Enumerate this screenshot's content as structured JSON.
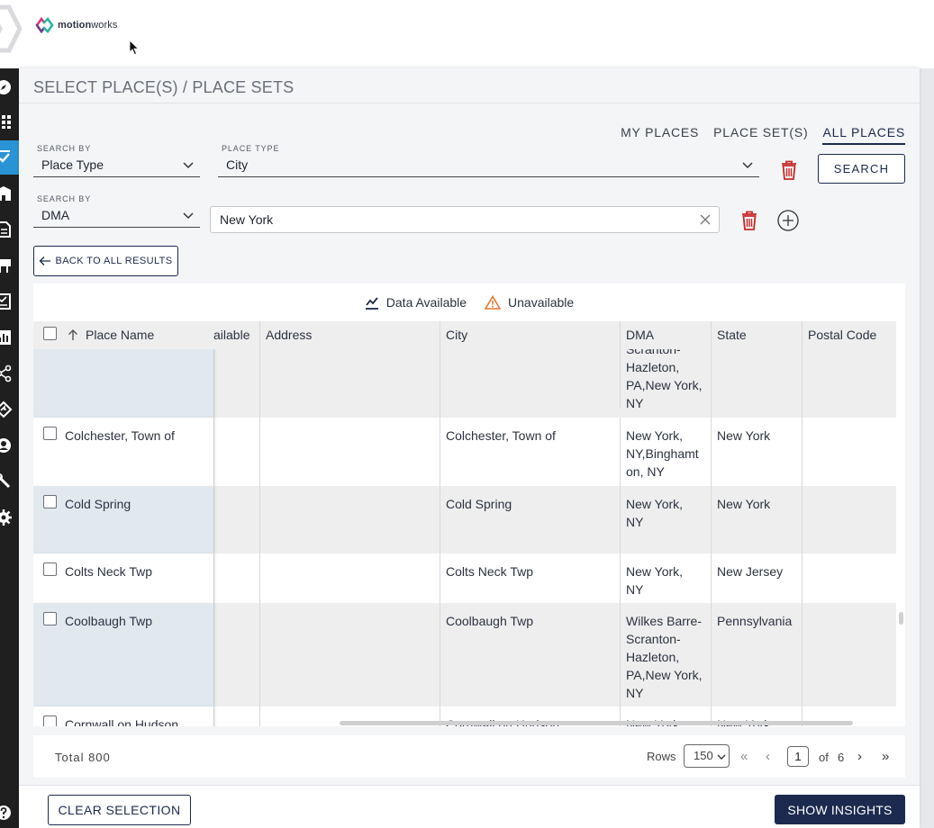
{
  "header": {
    "brand_bold": "motion",
    "brand_light": "works"
  },
  "panel": {
    "title": "SELECT PLACE(S) / PLACE SETS",
    "tabs": [
      {
        "label": "MY PLACES",
        "active": false
      },
      {
        "label": "PLACE SET(S)",
        "active": false
      },
      {
        "label": "ALL PLACES",
        "active": true
      }
    ]
  },
  "filters": {
    "row1": {
      "search_by_label": "SEARCH BY",
      "search_by_value": "Place Type",
      "place_type_label": "PLACE TYPE",
      "place_type_value": "City"
    },
    "row2": {
      "search_by_label": "SEARCH BY",
      "search_by_value": "DMA",
      "text_value": "New York"
    },
    "search_button": "SEARCH"
  },
  "back_button": "BACK TO ALL RESULTS",
  "legend": {
    "available": "Data Available",
    "unavailable": "Unavailable",
    "available_color": "#1b2a4e",
    "unavailable_color": "#e8772e"
  },
  "table": {
    "columns": [
      "Place Name",
      "ailable",
      "Address",
      "City",
      "DMA",
      "State",
      "Postal Code"
    ],
    "rows": [
      {
        "name": "",
        "city": "",
        "dma": "Scranton-\nHazleton,\nPA,New York,\nNY",
        "state": "",
        "postal": ""
      },
      {
        "name": "Colchester, Town of",
        "city": "Colchester, Town of",
        "dma": "New York,\nNY,Binghamt\non, NY",
        "state": "New York",
        "postal": ""
      },
      {
        "name": "Cold Spring",
        "city": "Cold Spring",
        "dma": "New York,\nNY",
        "state": "New York",
        "postal": ""
      },
      {
        "name": "Colts Neck Twp",
        "city": "Colts Neck Twp",
        "dma": "New York,\nNY",
        "state": "New Jersey",
        "postal": ""
      },
      {
        "name": "Coolbaugh Twp",
        "city": "Coolbaugh Twp",
        "dma": "Wilkes Barre-\nScranton-\nHazleton,\nPA,New York,\nNY",
        "state": "Pennsylvania",
        "postal": ""
      },
      {
        "name": "Cornwall on Hudson",
        "city": "Cornwall on Hudson",
        "dma": "New York,",
        "state": "New York",
        "postal": ""
      }
    ]
  },
  "pagination": {
    "total_label": "Total 800",
    "rows_label": "Rows",
    "rows_value": "150",
    "current_page": "1",
    "of_label": "of",
    "total_pages": "6",
    "first_icon": "«",
    "prev_icon": "‹",
    "next_icon": "›",
    "last_icon": "»"
  },
  "actions": {
    "clear": "CLEAR SELECTION",
    "insights": "SHOW INSIGHTS"
  }
}
